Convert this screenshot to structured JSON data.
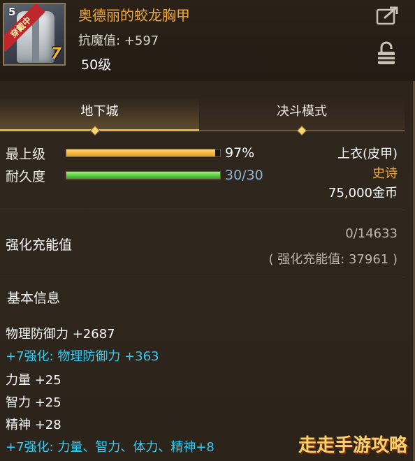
{
  "item": {
    "level": "5",
    "equipped_ribbon": "穿戴中",
    "enhance_level": "7",
    "name": "奥德丽的蛟龙胸甲",
    "stat_line": "抗魔值: +597",
    "required_level": "50级"
  },
  "icons": {
    "share": "share-icon",
    "lock": "lock-icon"
  },
  "tabs": [
    {
      "label": "地下城",
      "active": true
    },
    {
      "label": "决斗模式",
      "active": false
    }
  ],
  "bars": {
    "max_upgrade": {
      "label": "最上级",
      "value_text": "97%",
      "fraction": 0.97
    },
    "durability": {
      "label": "耐久度",
      "value_text": "30/30",
      "fraction": 1.0
    }
  },
  "item_info": {
    "slot": "上衣(皮甲)",
    "rarity": "史诗",
    "price": "75,000金币"
  },
  "charge": {
    "label": "强化充能值",
    "value": "0/14633",
    "sub": "( 强化充能值: 37961 )"
  },
  "basic_info": {
    "title": "基本信息",
    "lines": [
      {
        "text": "物理防御力 +2687",
        "style": "white"
      },
      {
        "text": "+7强化: 物理防御力 +363",
        "style": "cyan"
      },
      {
        "text": "力量 +25",
        "style": "white"
      },
      {
        "text": "智力 +25",
        "style": "white"
      },
      {
        "text": "精神 +28",
        "style": "white"
      },
      {
        "text": "+7强化: 力量、智力、体力、精神+8",
        "style": "cyan"
      }
    ]
  },
  "watermark": "走走手游攻略",
  "colors": {
    "item_name": "#f2a93b",
    "rarity": "#f2a93b",
    "enhance_text": "#37c9f0",
    "tab_accent": "#e0b44a"
  }
}
